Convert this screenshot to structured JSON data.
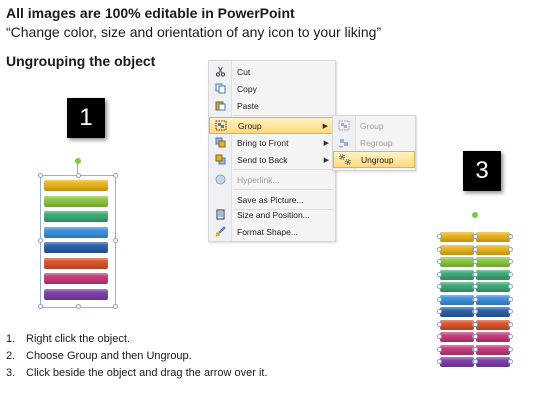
{
  "header": {
    "title": "All images are 100% editable in PowerPoint",
    "subtitle": "“Change color, size and orientation of any icon to your liking”",
    "section": "Ungrouping the object"
  },
  "steps_labels": [
    "1",
    "2",
    "3"
  ],
  "context_menu": {
    "items": [
      {
        "label": "Cut",
        "icon": "scissors-icon",
        "disabled": false
      },
      {
        "label": "Copy",
        "icon": "copy-icon",
        "disabled": false
      },
      {
        "label": "Paste",
        "icon": "paste-icon",
        "disabled": false
      },
      {
        "label": "Group",
        "icon": "group-icon",
        "disabled": false,
        "submenu": true,
        "highlighted": true
      },
      {
        "label": "Bring to Front",
        "icon": "bring-front-icon",
        "disabled": false,
        "submenu": true
      },
      {
        "label": "Send to Back",
        "icon": "send-back-icon",
        "disabled": false,
        "submenu": true
      },
      {
        "label": "Hyperlink...",
        "icon": "hyperlink-icon",
        "disabled": true
      },
      {
        "label": "Save as Picture...",
        "icon": "",
        "disabled": false
      },
      {
        "label": "Size and Position...",
        "icon": "size-position-icon",
        "disabled": false
      },
      {
        "label": "Format Shape...",
        "icon": "format-shape-icon",
        "disabled": false
      }
    ]
  },
  "submenu": {
    "items": [
      {
        "label": "Group",
        "icon": "group-icon",
        "disabled": true
      },
      {
        "label": "Regroup",
        "icon": "regroup-icon",
        "disabled": true
      },
      {
        "label": "Ungroup",
        "icon": "ungroup-icon",
        "disabled": false,
        "highlighted": true
      }
    ]
  },
  "bar_colors": [
    "#e8b21c",
    "#8cc63f",
    "#3aa874",
    "#3b8fd9",
    "#2b5fa8",
    "#d9532b",
    "#c43a7a",
    "#7b3fa8"
  ],
  "instructions": [
    {
      "num": "1.",
      "text": "Right click the object."
    },
    {
      "num": "2.",
      "text": "Choose Group and then Ungroup."
    },
    {
      "num": "3.",
      "text": "Click beside the object and drag the arrow over it."
    }
  ]
}
